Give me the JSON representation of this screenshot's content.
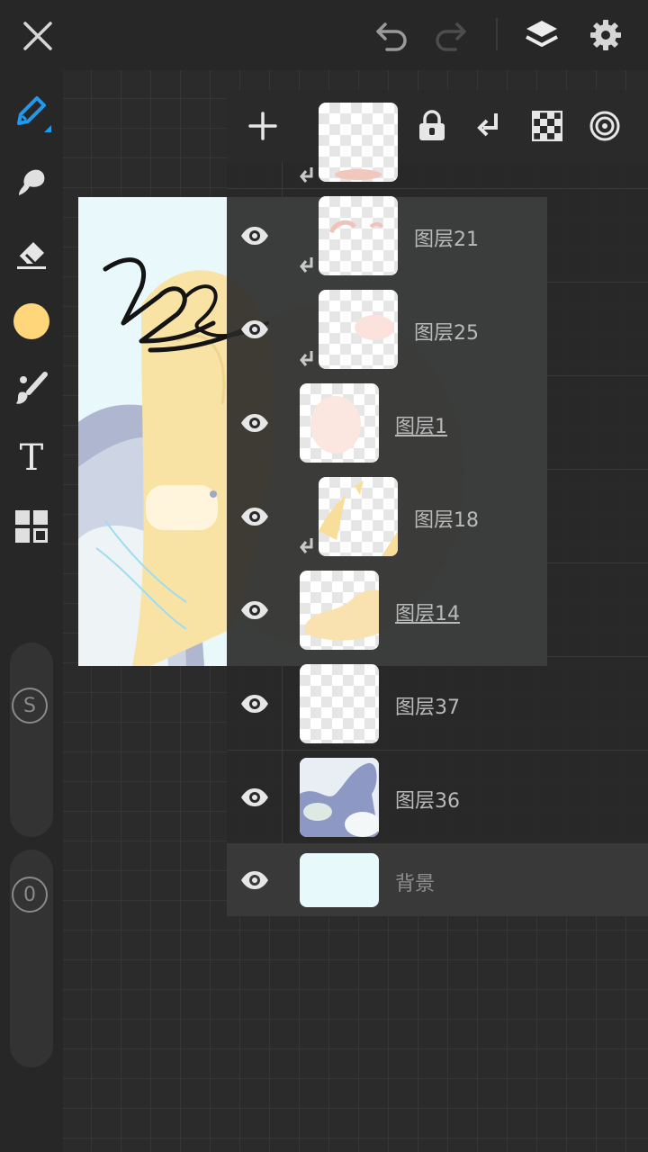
{
  "toolbar": {
    "close": "close-icon",
    "undo": "undo-icon",
    "redo": "redo-icon",
    "layers": "layers-icon",
    "settings": "gear-icon"
  },
  "tools": {
    "pen": "pen-icon",
    "smudge": "smudge-icon",
    "eraser": "eraser-icon",
    "color": "#ffd77a",
    "brush": "brush-icon",
    "text_tool": "T",
    "grid": "grid-icon"
  },
  "sliders": {
    "size_label": "S",
    "opacity_label": "0"
  },
  "accent": "#1e9bef",
  "layers_toolbar": [
    "add-icon",
    "folder-icon",
    "lock-icon",
    "clip-icon",
    "checker-icon",
    "radial-icon"
  ],
  "layers": [
    {
      "name": "",
      "clipped": true,
      "visible": true
    },
    {
      "name": "图层21",
      "clipped": true,
      "visible": true
    },
    {
      "name": "图层25",
      "clipped": true,
      "visible": true
    },
    {
      "name": "图层1",
      "clipped": false,
      "visible": true,
      "underlined": true
    },
    {
      "name": "图层18",
      "clipped": true,
      "visible": true
    },
    {
      "name": "图层14",
      "clipped": false,
      "visible": true,
      "underlined": true
    },
    {
      "name": "图层37",
      "clipped": false,
      "visible": true
    },
    {
      "name": "图层36",
      "clipped": false,
      "visible": true
    },
    {
      "name": "背景",
      "clipped": false,
      "visible": true,
      "selected": true
    }
  ]
}
